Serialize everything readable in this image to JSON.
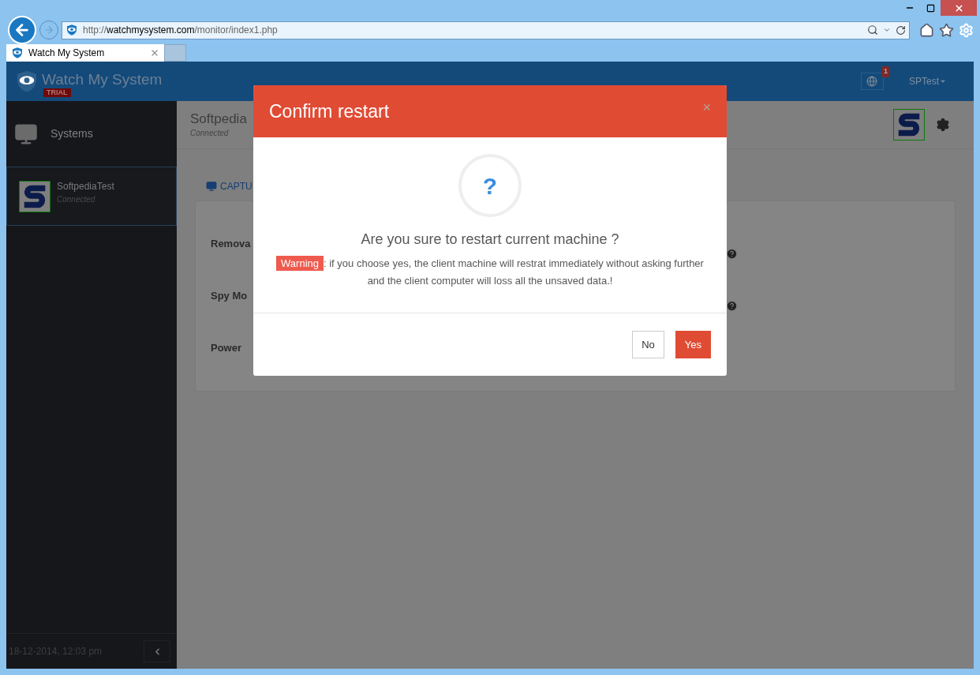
{
  "browser": {
    "url_scheme": "http://",
    "url_domain": "watchmysystem.com",
    "url_path": "/monitor/index1.php",
    "tab_title": "Watch My System"
  },
  "header": {
    "brand": "Watch My System",
    "badge": "TRIAL",
    "notification_count": "1",
    "user": "SPTest"
  },
  "sidebar": {
    "title": "Systems",
    "systems": [
      {
        "name": "SoftpediaTest",
        "status": "Connected",
        "selected": true
      }
    ],
    "timestamp": "18-12-2014, 12:03 pm"
  },
  "main": {
    "title": "Softpedia",
    "status": "Connected",
    "tab": "CAPTU",
    "settings": [
      "Remova",
      "Spy Mo",
      "Power"
    ]
  },
  "dialog": {
    "title": "Confirm restart",
    "close": "×",
    "question_mark": "?",
    "question": "Are you sure to restart current machine ?",
    "warning_label": "Warning",
    "warning_text": ": if you choose yes, the client machine will restrat immediately without asking further and the client computer will loss all the unsaved data.!",
    "buttons": [
      {
        "label": "No",
        "kind": "default"
      },
      {
        "label": "Yes",
        "kind": "primary"
      }
    ]
  }
}
